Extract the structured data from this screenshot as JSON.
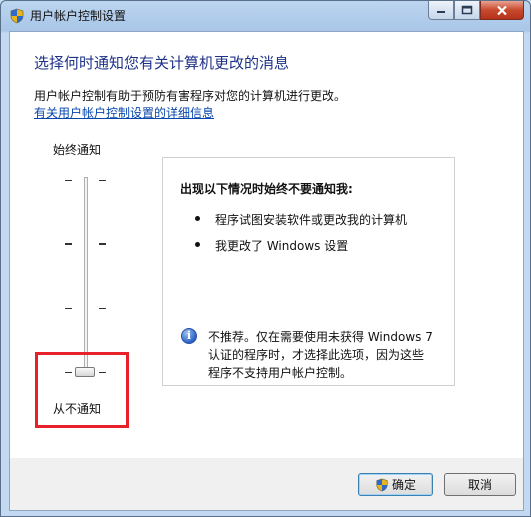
{
  "window": {
    "title": "用户帐户控制设置"
  },
  "main": {
    "heading": "选择何时通知您有关计算机更改的消息",
    "description": "用户帐户控制有助于预防有害程序对您的计算机进行更改。",
    "link": "有关用户帐户控制设置的详细信息"
  },
  "slider": {
    "top_label": "始终通知",
    "bottom_label": "从不通知",
    "levels": 4,
    "selected_level": 1
  },
  "panel": {
    "heading": "出现以下情况时始终不要通知我:",
    "bullets": [
      "程序试图安装软件或更改我的计算机",
      "我更改了 Windows 设置"
    ],
    "note_lines": [
      "不推荐。仅在需要使用未获得 Windows 7",
      "认证的程序时，才选择此选项，因为这些",
      "程序不支持用户帐户控制。"
    ]
  },
  "buttons": {
    "ok": "确定",
    "cancel": "取消"
  },
  "colors": {
    "heading": "#1e3287",
    "link": "#0645ad",
    "highlight_box": "#e8202a"
  },
  "icons": [
    "uac-shield-icon",
    "minimize-icon",
    "maximize-icon",
    "close-icon",
    "info-icon"
  ]
}
